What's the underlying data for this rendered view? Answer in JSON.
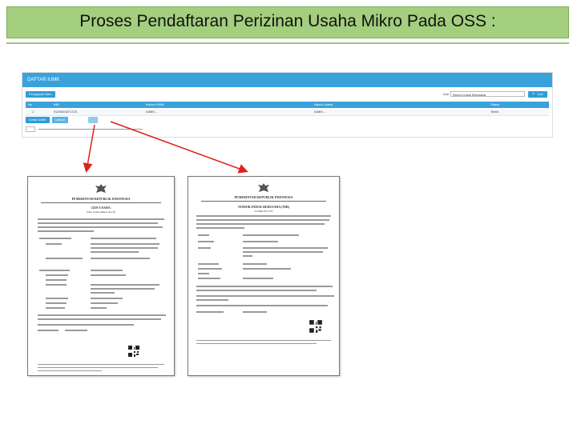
{
  "slide": {
    "title": "Proses Pendaftaran Perizinan Usaha Mikro Pada OSS :"
  },
  "app": {
    "header": "DAFTAR IUMK",
    "toolbar": {
      "new_button": "Pengajuan Baru",
      "search_label": "Cari",
      "search_value": "Nomor Induk Berusaha",
      "search_button": "Cari"
    },
    "table": {
      "columns": [
        "No",
        "NIB",
        "Nomor IUMK",
        "Nama Usaha",
        "Status"
      ],
      "rows": [
        [
          "1",
          "9120001871723",
          "IUMK/…",
          "IUMK/…",
          "Terbit"
        ]
      ]
    },
    "actions": {
      "print_button": "Cetak IUMK",
      "download_button": "Unduh",
      "more_button": "…"
    }
  },
  "documents": {
    "left": {
      "heading": "PEMERINTAH REPUBLIK INDONESIA",
      "title": "IZIN USAHA",
      "subtitle": "(Izin Usaha Mikro Kecil)"
    },
    "right": {
      "heading": "PEMERINTAH REPUBLIK INDONESIA",
      "title": "NOMOR INDUK BERUSAHA (NIB)",
      "subtitle": "9120001871723"
    }
  },
  "colors": {
    "title_bar": "#a3cf7e",
    "app_header": "#3aa2db",
    "arrow": "#e0201b"
  }
}
